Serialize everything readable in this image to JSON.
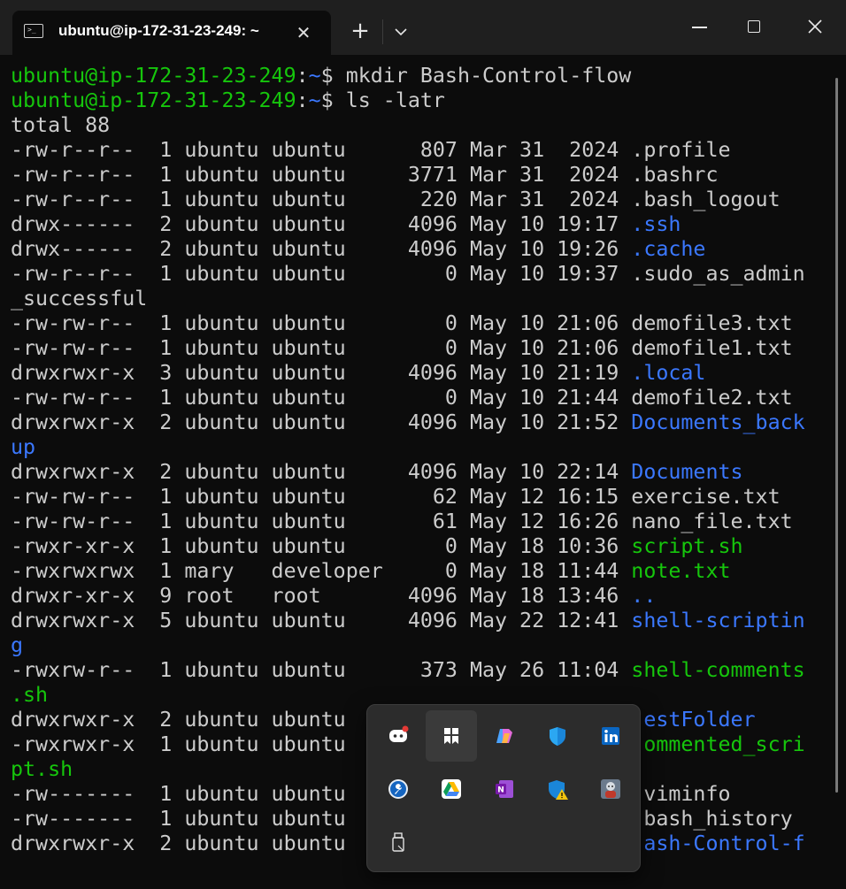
{
  "window": {
    "tab_title": "ubuntu@ip-172-31-23-249: ~",
    "close_tab_glyph": "✕",
    "new_tab_glyph": "+"
  },
  "terminal": {
    "lines": [
      [
        {
          "t": "ubuntu@ip-172-31-23-249",
          "c": "g"
        },
        {
          "t": ":",
          "c": "w"
        },
        {
          "t": "~",
          "c": "b"
        },
        {
          "t": "$ mkdir Bash-Control-flow",
          "c": "w"
        }
      ],
      [
        {
          "t": "ubuntu@ip-172-31-23-249",
          "c": "g"
        },
        {
          "t": ":",
          "c": "w"
        },
        {
          "t": "~",
          "c": "b"
        },
        {
          "t": "$ ls -latr",
          "c": "w"
        }
      ],
      [
        {
          "t": "total 88",
          "c": "w"
        }
      ],
      [
        {
          "t": "-rw-r--r--  1 ubuntu ubuntu      807 Mar 31  2024 .profile",
          "c": "w"
        }
      ],
      [
        {
          "t": "-rw-r--r--  1 ubuntu ubuntu     3771 Mar 31  2024 .bashrc",
          "c": "w"
        }
      ],
      [
        {
          "t": "-rw-r--r--  1 ubuntu ubuntu      220 Mar 31  2024 .bash_logout",
          "c": "w"
        }
      ],
      [
        {
          "t": "drwx------  2 ubuntu ubuntu     4096 May 10 19:17 ",
          "c": "w"
        },
        {
          "t": ".ssh",
          "c": "b"
        }
      ],
      [
        {
          "t": "drwx------  2 ubuntu ubuntu     4096 May 10 19:26 ",
          "c": "w"
        },
        {
          "t": ".cache",
          "c": "b"
        }
      ],
      [
        {
          "t": "-rw-r--r--  1 ubuntu ubuntu        0 May 10 19:37 .sudo_as_admin",
          "c": "w"
        }
      ],
      [
        {
          "t": "_successful",
          "c": "w"
        }
      ],
      [
        {
          "t": "-rw-rw-r--  1 ubuntu ubuntu        0 May 10 21:06 demofile3.txt",
          "c": "w"
        }
      ],
      [
        {
          "t": "-rw-rw-r--  1 ubuntu ubuntu        0 May 10 21:06 demofile1.txt",
          "c": "w"
        }
      ],
      [
        {
          "t": "drwxrwxr-x  3 ubuntu ubuntu     4096 May 10 21:19 ",
          "c": "w"
        },
        {
          "t": ".local",
          "c": "b"
        }
      ],
      [
        {
          "t": "-rw-rw-r--  1 ubuntu ubuntu        0 May 10 21:44 demofile2.txt",
          "c": "w"
        }
      ],
      [
        {
          "t": "drwxrwxr-x  2 ubuntu ubuntu     4096 May 10 21:52 ",
          "c": "w"
        },
        {
          "t": "Documents_back",
          "c": "b"
        }
      ],
      [
        {
          "t": "up",
          "c": "b"
        }
      ],
      [
        {
          "t": "drwxrwxr-x  2 ubuntu ubuntu     4096 May 10 22:14 ",
          "c": "w"
        },
        {
          "t": "Documents",
          "c": "b"
        }
      ],
      [
        {
          "t": "-rw-rw-r--  1 ubuntu ubuntu       62 May 12 16:15 exercise.txt",
          "c": "w"
        }
      ],
      [
        {
          "t": "-rw-rw-r--  1 ubuntu ubuntu       61 May 12 16:26 nano_file.txt",
          "c": "w"
        }
      ],
      [
        {
          "t": "-rwxr-xr-x  1 ubuntu ubuntu        0 May 18 10:36 ",
          "c": "w"
        },
        {
          "t": "script.sh",
          "c": "g"
        }
      ],
      [
        {
          "t": "-rwxrwxrwx  1 mary   developer     0 May 18 11:44 ",
          "c": "w"
        },
        {
          "t": "note.txt",
          "c": "g"
        }
      ],
      [
        {
          "t": "drwxr-xr-x  9 root   root       4096 May 18 13:46 ",
          "c": "w"
        },
        {
          "t": "..",
          "c": "b"
        }
      ],
      [
        {
          "t": "drwxrwxr-x  5 ubuntu ubuntu     4096 May 22 12:41 ",
          "c": "w"
        },
        {
          "t": "shell-scriptin",
          "c": "b"
        }
      ],
      [
        {
          "t": "g",
          "c": "b"
        }
      ],
      [
        {
          "t": "-rwxrw-r--  1 ubuntu ubuntu      373 May 26 11:04 ",
          "c": "w"
        },
        {
          "t": "shell-comments",
          "c": "g"
        }
      ],
      [
        {
          "t": ".sh",
          "c": "g"
        }
      ],
      [
        {
          "t": "drwxrwxr-x  2 ubuntu ubuntu                        ",
          "c": "w"
        },
        {
          "t": "estFolder",
          "c": "b"
        }
      ],
      [
        {
          "t": "-rwxrwxr-x  1 ubuntu ubuntu                        ",
          "c": "w"
        },
        {
          "t": "ommented_scri",
          "c": "g"
        }
      ],
      [
        {
          "t": "pt.sh",
          "c": "g"
        }
      ],
      [
        {
          "t": "-rw-------  1 ubuntu ubuntu                        viminfo",
          "c": "w"
        }
      ],
      [
        {
          "t": "-rw-------  1 ubuntu ubuntu                        bash_history",
          "c": "w"
        }
      ],
      [
        {
          "t": "drwxrwxr-x  2 ubuntu ubuntu                        ",
          "c": "w"
        },
        {
          "t": "ash-Control-f",
          "c": "b"
        }
      ]
    ]
  },
  "tray_icons": [
    "discord-icon",
    "pinned-app-icon",
    "copilot-icon",
    "defender-shield-icon",
    "linkedin-icon",
    "settings-wrench-icon",
    "google-drive-icon",
    "onenote-icon",
    "defender-warning-icon",
    "avatar-app-icon",
    "usb-drive-icon"
  ],
  "colors": {
    "terminal_bg": "#0c0c0c",
    "prompt_user": "#16c60c",
    "prompt_path": "#3b78ff",
    "directory": "#3b78ff",
    "executable": "#16c60c",
    "text": "#cccccc"
  }
}
